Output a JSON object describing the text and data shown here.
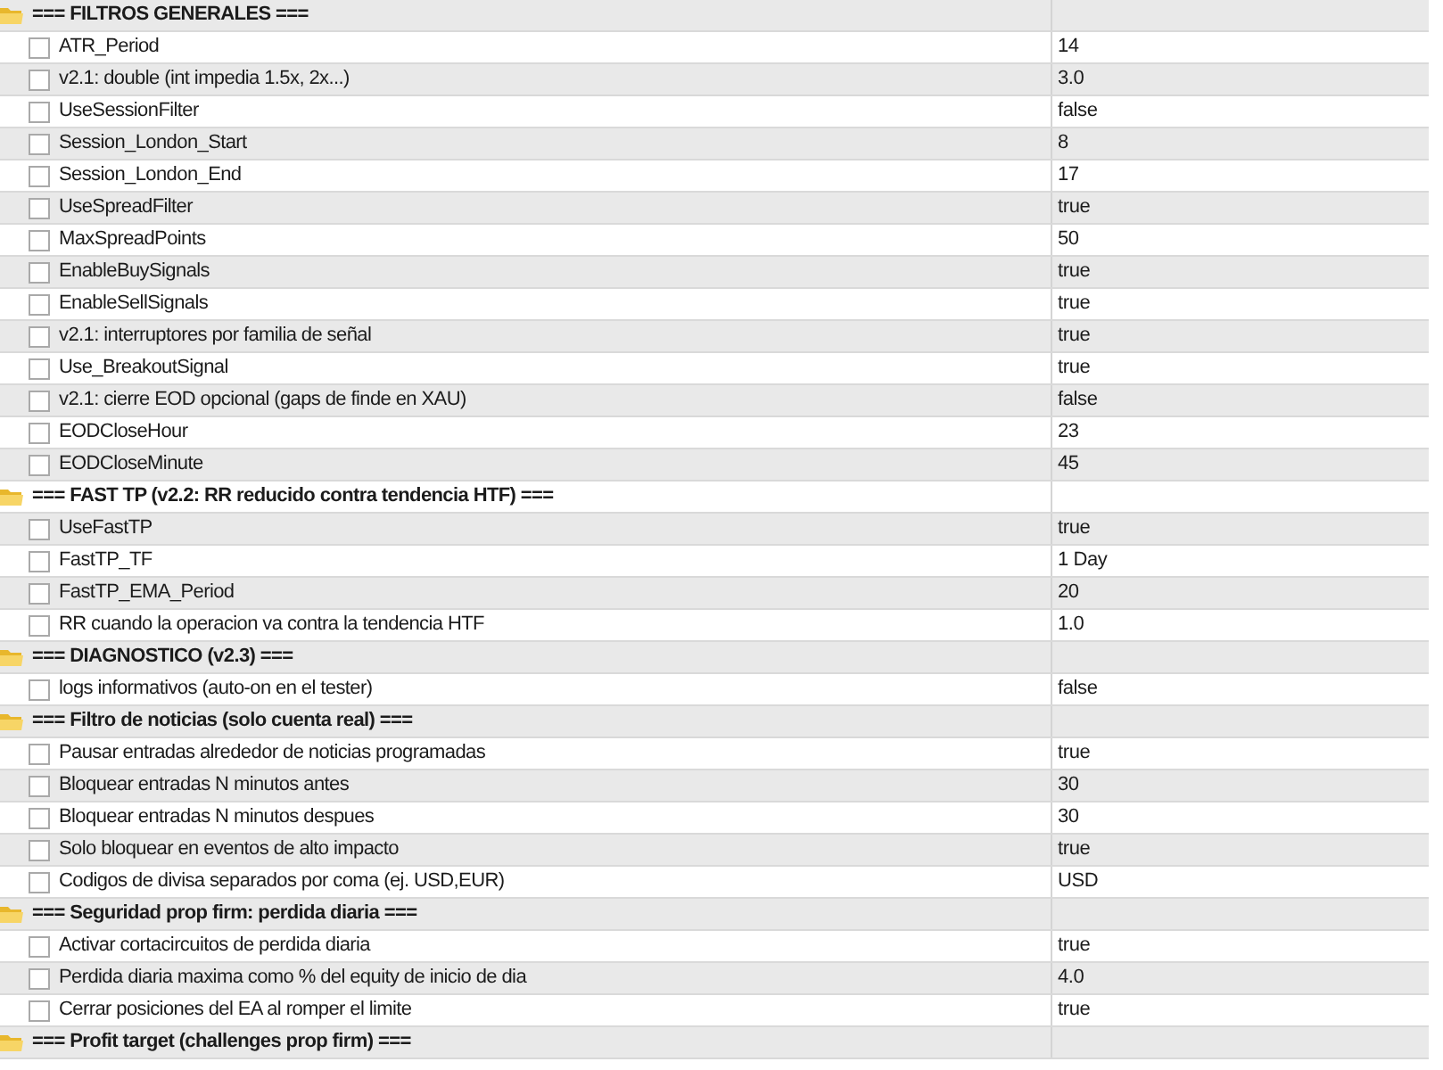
{
  "table": {
    "groups": [
      {
        "title": "=== FILTROS GENERALES ===",
        "children": [
          {
            "name": "ATR_Period",
            "value": "14",
            "checked": false
          },
          {
            "name": "v2.1: double (int impedia 1.5x, 2x...)",
            "value": "3.0",
            "checked": false
          },
          {
            "name": "UseSessionFilter",
            "value": "false",
            "checked": false
          },
          {
            "name": "Session_London_Start",
            "value": "8",
            "checked": false
          },
          {
            "name": "Session_London_End",
            "value": "17",
            "checked": false
          },
          {
            "name": "UseSpreadFilter",
            "value": "true",
            "checked": false
          },
          {
            "name": "MaxSpreadPoints",
            "value": "50",
            "checked": false
          },
          {
            "name": "EnableBuySignals",
            "value": "true",
            "checked": false
          },
          {
            "name": "EnableSellSignals",
            "value": "true",
            "checked": false
          },
          {
            "name": "v2.1: interruptores por familia de señal",
            "value": "true",
            "checked": false
          },
          {
            "name": "Use_BreakoutSignal",
            "value": "true",
            "checked": false
          },
          {
            "name": "v2.1: cierre EOD opcional (gaps de finde en XAU)",
            "value": "false",
            "checked": false
          },
          {
            "name": "EODCloseHour",
            "value": "23",
            "checked": false
          },
          {
            "name": "EODCloseMinute",
            "value": "45",
            "checked": false
          }
        ]
      },
      {
        "title": "=== FAST TP (v2.2: RR reducido contra tendencia HTF) ===",
        "children": [
          {
            "name": "UseFastTP",
            "value": "true",
            "checked": false
          },
          {
            "name": "FastTP_TF",
            "value": "1 Day",
            "checked": false
          },
          {
            "name": "FastTP_EMA_Period",
            "value": "20",
            "checked": false
          },
          {
            "name": "RR cuando la operacion va contra la tendencia HTF",
            "value": "1.0",
            "checked": false
          }
        ]
      },
      {
        "title": "=== DIAGNOSTICO (v2.3) ===",
        "children": [
          {
            "name": "logs informativos (auto-on en el tester)",
            "value": "false",
            "checked": false
          }
        ]
      },
      {
        "title": "=== Filtro de noticias (solo cuenta real) ===",
        "children": [
          {
            "name": "Pausar entradas alrededor de noticias programadas",
            "value": "true",
            "checked": false
          },
          {
            "name": "Bloquear entradas N minutos antes",
            "value": "30",
            "checked": false
          },
          {
            "name": "Bloquear entradas N minutos despues",
            "value": "30",
            "checked": false
          },
          {
            "name": "Solo bloquear en eventos de alto impacto",
            "value": "true",
            "checked": false
          },
          {
            "name": "Codigos de divisa separados por coma (ej. USD,EUR)",
            "value": "USD",
            "checked": false
          }
        ]
      },
      {
        "title": "=== Seguridad prop firm: perdida diaria ===",
        "children": [
          {
            "name": "Activar cortacircuitos de perdida diaria",
            "value": "true",
            "checked": false
          },
          {
            "name": "Perdida diaria maxima como % del equity de inicio de dia",
            "value": "4.0",
            "checked": false
          },
          {
            "name": "Cerrar posiciones del EA al romper el limite",
            "value": "true",
            "checked": false
          }
        ]
      },
      {
        "title": "=== Profit target (challenges prop firm) ==="
      }
    ]
  }
}
